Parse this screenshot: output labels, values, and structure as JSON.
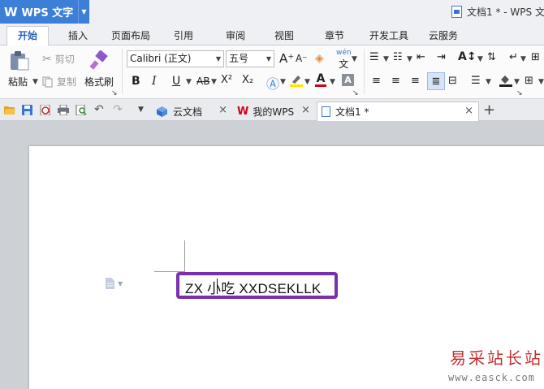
{
  "app": {
    "logo": "W",
    "name": "WPS 文字",
    "title": "文档1 * - WPS 文"
  },
  "menu": {
    "tabs": [
      "开始",
      "插入",
      "页面布局",
      "引用",
      "审阅",
      "视图",
      "章节",
      "开发工具",
      "云服务"
    ]
  },
  "ribbon": {
    "paste": "粘贴",
    "cut": "剪切",
    "copy": "复制",
    "format_painter": "格式刷",
    "font_name": "Calibri (正文)",
    "font_size": "五号",
    "bold": "B",
    "italic": "I",
    "underline": "U",
    "strike": "AB",
    "superscript": "X²",
    "subscript": "X₂",
    "font_color_letter": "A",
    "grow_font": "A⁺",
    "shrink_font": "A⁻",
    "phonetic": "wén"
  },
  "doc_tabs": [
    {
      "label": "云文档"
    },
    {
      "label": "我的WPS"
    },
    {
      "label": "文档1 *"
    }
  ],
  "document": {
    "text": "ZX 小吃 XXDSEKLLK"
  },
  "watermark": {
    "line1": "易采站长站",
    "line2": "www.easck.com"
  },
  "colors": {
    "accent": "#3c7fd6",
    "selection_border": "#7a2fae",
    "highlight": "#ffe400",
    "font_red": "#d0021b",
    "watermark_red": "#c0302e"
  }
}
